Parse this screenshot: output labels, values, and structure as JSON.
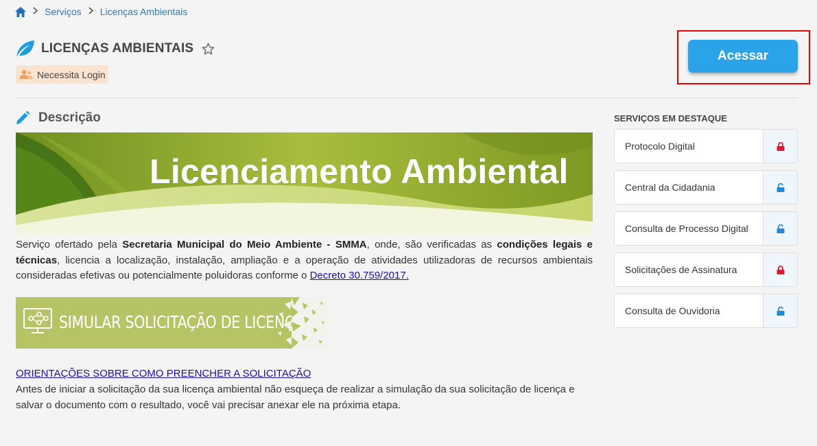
{
  "breadcrumb": {
    "home_icon": "home-icon",
    "items": [
      "Serviços",
      "Licenças Ambientais"
    ]
  },
  "header": {
    "title": "LICENÇAS AMBIENTAIS",
    "leaf_icon": "leaf-icon",
    "star_icon": "star-outline-icon",
    "badge": {
      "label": "Necessita Login",
      "icon": "user-group-icon",
      "color": "#fbe3d1"
    },
    "access_button": {
      "label": "Acessar",
      "color": "#2ba3e8"
    }
  },
  "description": {
    "title": "Descrição",
    "icon": "pencil-icon",
    "banner_text": "Licenciamento Ambiental",
    "paragraph": {
      "p1": "Serviço ofertado pela ",
      "b1": "Secretaria Municipal do Meio Ambiente - SMMA",
      "p2": ", onde, são verificadas as ",
      "b2": "condições legais e técnicas",
      "p3": ", licencia a localização, instalação, ampliação e a operação de atividades utilizadoras de recursos ambientais consideradas efetivas ou potencialmente poluidoras conforme o ",
      "link": "Decreto 30.759/2017."
    },
    "sim_banner_text": "SIMULAR SOLICITAÇÃO DE LICENÇA",
    "orientation_link": "ORIENTAÇÕES SOBRE COMO PREENCHER A SOLICITAÇÃO",
    "orientation_text": "Antes de iniciar a solicitação da sua licença ambiental não esqueça de realizar a simulação da sua solicitação de licença e salvar o documento com o resultado, você vai precisar anexar ele na próxima etapa."
  },
  "sidebar": {
    "title": "SERVIÇOS EM DESTAQUE",
    "items": [
      {
        "label": "Protocolo Digital",
        "lock": "locked",
        "icon": "lock-icon",
        "color": "#e0182d"
      },
      {
        "label": "Central da Cidadania",
        "lock": "unlocked",
        "icon": "unlock-icon",
        "color": "#1e8ad8"
      },
      {
        "label": "Consulta de Processo Digital",
        "lock": "unlocked",
        "icon": "unlock-icon",
        "color": "#1e8ad8"
      },
      {
        "label": "Solicitações de Assinatura",
        "lock": "locked",
        "icon": "lock-icon",
        "color": "#e0182d"
      },
      {
        "label": "Consulta de Ouvidoria",
        "lock": "unlocked",
        "icon": "unlock-icon",
        "color": "#1e8ad8"
      }
    ]
  }
}
